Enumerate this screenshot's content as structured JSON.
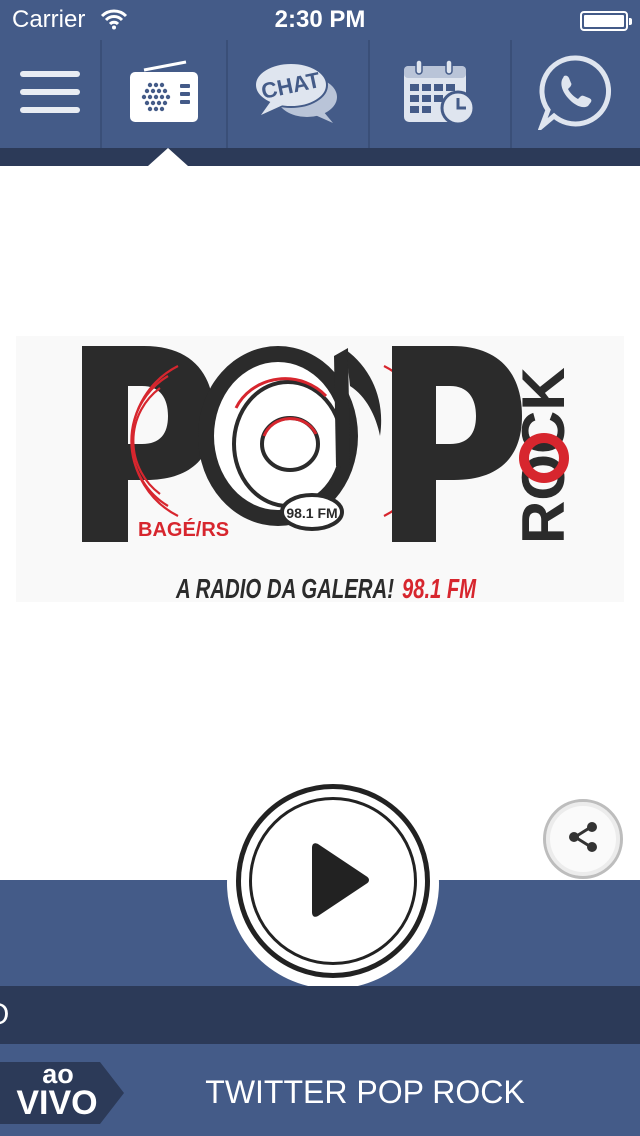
{
  "status_bar": {
    "carrier": "Carrier",
    "time": "2:30 PM"
  },
  "toolbar": {
    "items": [
      {
        "icon": "menu-icon"
      },
      {
        "icon": "radio-icon",
        "active": true
      },
      {
        "icon": "chat-icon",
        "text": "CHAT"
      },
      {
        "icon": "calendar-icon"
      },
      {
        "icon": "whatsapp-icon"
      }
    ]
  },
  "logo": {
    "brand": "POP",
    "word_rock": "ROCK",
    "city": "BAGÉ/RS",
    "frequency_badge": "98.1 FM",
    "slogan": "A RADIO DA GALERA!",
    "slogan_frequency": "98.1 FM"
  },
  "player": {
    "play_icon": "play-icon",
    "share_icon": "share-icon"
  },
  "ticker": {
    "text": "O"
  },
  "footer": {
    "live_ao": "ao",
    "live_vivo": "VIVO",
    "title": "TWITTER POP ROCK"
  },
  "colors": {
    "bar": "#445b88",
    "bar_dark": "#2c3a58",
    "logo_red": "#d7262e",
    "logo_dark": "#2b2b2b"
  }
}
